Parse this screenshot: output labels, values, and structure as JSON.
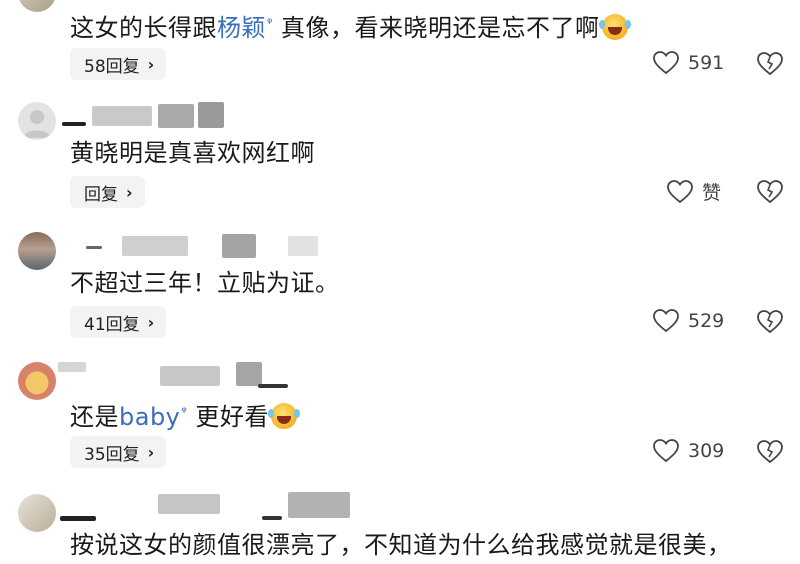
{
  "comments": [
    {
      "segments": [
        {
          "text": "这女的长得跟",
          "link": false
        },
        {
          "text": "杨颖",
          "link": true
        },
        {
          "text": " 真像，看来晓明还是忘不了啊",
          "link": false
        }
      ],
      "emoji": "laugh-cry-emoji",
      "reply_label": "58回复",
      "like_count": "591"
    },
    {
      "segments": [
        {
          "text": "黄晓明是真喜欢网红啊",
          "link": false
        }
      ],
      "reply_label": "回复",
      "like_count": "赞"
    },
    {
      "segments": [
        {
          "text": "不超过三年！立贴为证。",
          "link": false
        }
      ],
      "reply_label": "41回复",
      "like_count": "529"
    },
    {
      "segments": [
        {
          "text": "还是",
          "link": false
        },
        {
          "text": "baby",
          "link": true
        },
        {
          "text": " 更好看",
          "link": false
        }
      ],
      "emoji": "laugh-cry-emoji",
      "reply_label": "35回复",
      "like_count": "309"
    },
    {
      "segments": [
        {
          "text": "按说这女的颜值很漂亮了，不知道为什么给我感觉就是很美，",
          "link": false
        }
      ]
    }
  ],
  "icons": {
    "like": "heart-icon",
    "dislike": "broken-heart-icon",
    "reply_chevron": "chevron-right-icon",
    "link_search": "search-mark-icon"
  },
  "colors": {
    "link": "#3a6fb8",
    "reply_button_bg": "#f2f3f5",
    "text": "#1a1a1a"
  }
}
